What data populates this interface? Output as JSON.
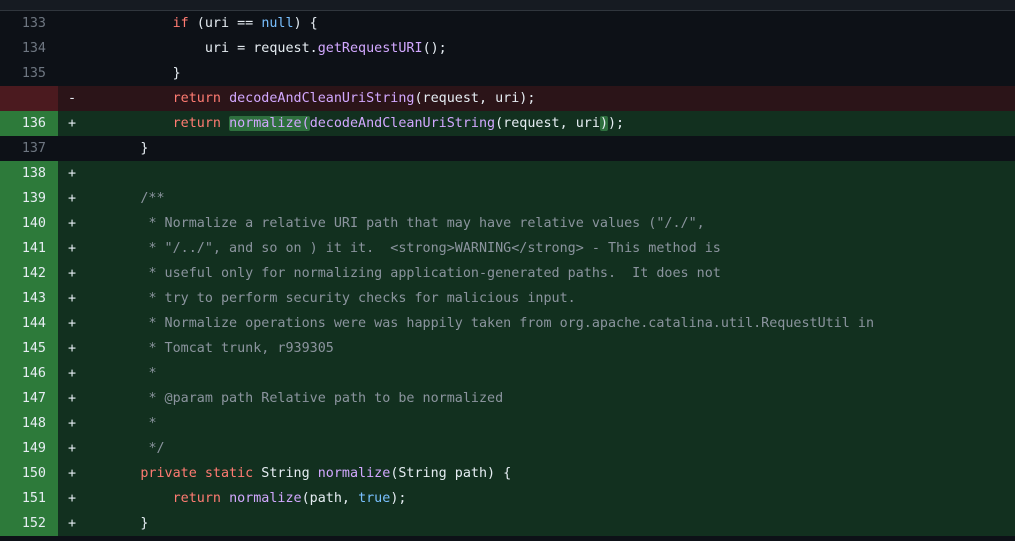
{
  "diff": {
    "lines": [
      {
        "type": "ctx",
        "num": "133",
        "marker": "",
        "indent": "          ",
        "tokens": [
          {
            "t": "kw",
            "v": "if"
          },
          {
            "t": "pl",
            "v": " (uri == "
          },
          {
            "t": "lit",
            "v": "null"
          },
          {
            "t": "pl",
            "v": ") {"
          }
        ]
      },
      {
        "type": "ctx",
        "num": "134",
        "marker": "",
        "indent": "              ",
        "tokens": [
          {
            "t": "pl",
            "v": "uri = request."
          },
          {
            "t": "fn",
            "v": "getRequestURI"
          },
          {
            "t": "pl",
            "v": "();"
          }
        ]
      },
      {
        "type": "ctx",
        "num": "135",
        "marker": "",
        "indent": "          ",
        "tokens": [
          {
            "t": "pl",
            "v": "}"
          }
        ]
      },
      {
        "type": "del",
        "num": "",
        "marker": "-",
        "indent": "          ",
        "tokens": [
          {
            "t": "kw",
            "v": "return"
          },
          {
            "t": "pl",
            "v": " "
          },
          {
            "t": "fn",
            "v": "decodeAndCleanUriString"
          },
          {
            "t": "pl",
            "v": "(request, uri);"
          }
        ]
      },
      {
        "type": "add",
        "num": "136",
        "marker": "+",
        "indent": "          ",
        "tokens": [
          {
            "t": "kw",
            "v": "return"
          },
          {
            "t": "pl",
            "v": " "
          },
          {
            "t": "fnhl",
            "v": "normalize("
          },
          {
            "t": "fn",
            "v": "decodeAndCleanUriString"
          },
          {
            "t": "pl",
            "v": "(request, uri"
          },
          {
            "t": "hl",
            "v": ")"
          },
          {
            "t": "pl",
            "v": ");"
          }
        ]
      },
      {
        "type": "ctx",
        "num": "137",
        "marker": "",
        "indent": "      ",
        "tokens": [
          {
            "t": "pl",
            "v": "}"
          }
        ]
      },
      {
        "type": "add",
        "num": "138",
        "marker": "+",
        "indent": "",
        "tokens": []
      },
      {
        "type": "add",
        "num": "139",
        "marker": "+",
        "indent": "      ",
        "tokens": [
          {
            "t": "cm",
            "v": "/**"
          }
        ]
      },
      {
        "type": "add",
        "num": "140",
        "marker": "+",
        "indent": "       ",
        "tokens": [
          {
            "t": "cm",
            "v": "* Normalize a relative URI path that may have relative values (\"/./\","
          }
        ]
      },
      {
        "type": "add",
        "num": "141",
        "marker": "+",
        "indent": "       ",
        "tokens": [
          {
            "t": "cm",
            "v": "* \"/../\", and so on ) it it.  <strong>WARNING</strong> - This method is"
          }
        ]
      },
      {
        "type": "add",
        "num": "142",
        "marker": "+",
        "indent": "       ",
        "tokens": [
          {
            "t": "cm",
            "v": "* useful only for normalizing application-generated paths.  It does not"
          }
        ]
      },
      {
        "type": "add",
        "num": "143",
        "marker": "+",
        "indent": "       ",
        "tokens": [
          {
            "t": "cm",
            "v": "* try to perform security checks for malicious input."
          }
        ]
      },
      {
        "type": "add",
        "num": "144",
        "marker": "+",
        "indent": "       ",
        "tokens": [
          {
            "t": "cm",
            "v": "* Normalize operations were was happily taken from org.apache.catalina.util.RequestUtil in"
          }
        ]
      },
      {
        "type": "add",
        "num": "145",
        "marker": "+",
        "indent": "       ",
        "tokens": [
          {
            "t": "cm",
            "v": "* Tomcat trunk, r939305"
          }
        ]
      },
      {
        "type": "add",
        "num": "146",
        "marker": "+",
        "indent": "       ",
        "tokens": [
          {
            "t": "cm",
            "v": "*"
          }
        ]
      },
      {
        "type": "add",
        "num": "147",
        "marker": "+",
        "indent": "       ",
        "tokens": [
          {
            "t": "cm",
            "v": "* @param path Relative path to be normalized"
          }
        ]
      },
      {
        "type": "add",
        "num": "148",
        "marker": "+",
        "indent": "       ",
        "tokens": [
          {
            "t": "cm",
            "v": "*"
          }
        ]
      },
      {
        "type": "add",
        "num": "149",
        "marker": "+",
        "indent": "       ",
        "tokens": [
          {
            "t": "cm",
            "v": "*/"
          }
        ]
      },
      {
        "type": "add",
        "num": "150",
        "marker": "+",
        "indent": "      ",
        "tokens": [
          {
            "t": "kw",
            "v": "private"
          },
          {
            "t": "pl",
            "v": " "
          },
          {
            "t": "kw",
            "v": "static"
          },
          {
            "t": "pl",
            "v": " String "
          },
          {
            "t": "fn",
            "v": "normalize"
          },
          {
            "t": "pl",
            "v": "(String path) {"
          }
        ]
      },
      {
        "type": "add",
        "num": "151",
        "marker": "+",
        "indent": "          ",
        "tokens": [
          {
            "t": "kw",
            "v": "return"
          },
          {
            "t": "pl",
            "v": " "
          },
          {
            "t": "fn",
            "v": "normalize"
          },
          {
            "t": "pl",
            "v": "(path, "
          },
          {
            "t": "lit",
            "v": "true"
          },
          {
            "t": "pl",
            "v": ");"
          }
        ]
      },
      {
        "type": "add",
        "num": "152",
        "marker": "+",
        "indent": "      ",
        "tokens": [
          {
            "t": "pl",
            "v": "}"
          }
        ]
      }
    ]
  },
  "colors": {
    "background": "#0d1117",
    "added_line": "#12301f",
    "added_gutter": "#2d7a3a",
    "deleted_line": "#2b1418",
    "deleted_gutter": "#4b1a1f",
    "keyword": "#ff7b72",
    "function": "#d2a8ff",
    "literal": "#79c0ff",
    "comment": "#8b949e"
  }
}
